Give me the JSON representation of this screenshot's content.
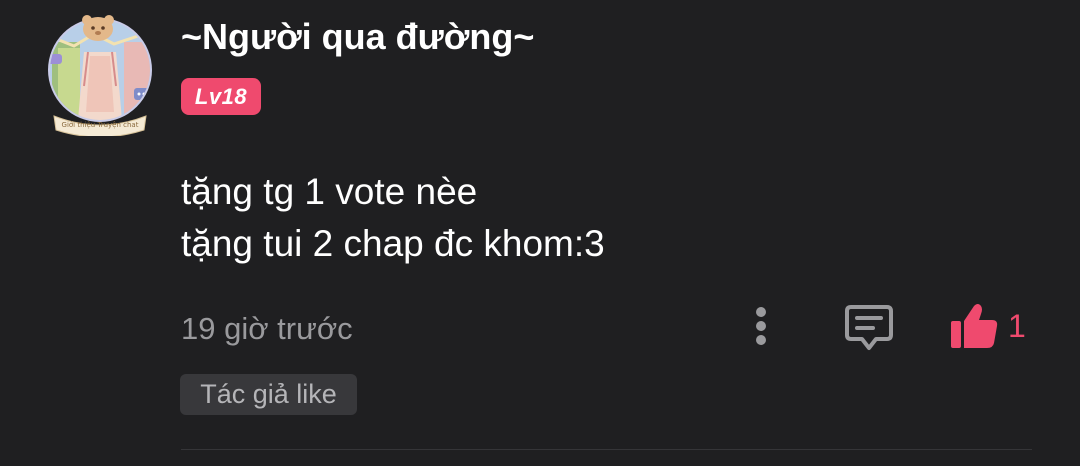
{
  "user": {
    "name": "~Người qua đường~",
    "level": "Lv18",
    "avatar_caption": "Giới thiệu Truyện chat"
  },
  "comment": {
    "line1": "tặng tg 1 vote nèe",
    "line2": "tặng tui 2 chap đc khom:3"
  },
  "meta": {
    "timestamp": "19 giờ trước",
    "like_count": "1",
    "author_like_label": "Tác giả like"
  },
  "icons": {
    "more": "more-vertical-icon",
    "reply": "comment-icon",
    "like": "thumbs-up-icon"
  },
  "colors": {
    "background": "#1f1f21",
    "accent": "#ef4a6e",
    "muted_text": "#9a9a9d",
    "tag_bg": "#38383b"
  }
}
